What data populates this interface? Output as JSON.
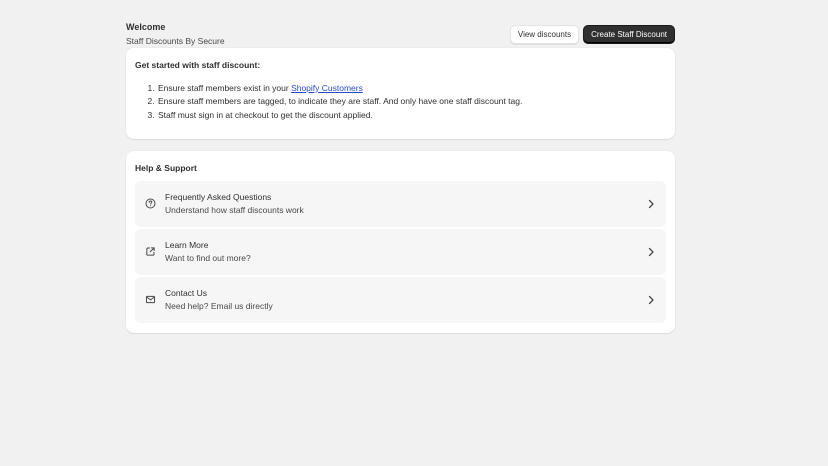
{
  "header": {
    "title": "Welcome",
    "subtitle": "Staff Discounts By Secure",
    "view_discounts_label": "View discounts",
    "create_discount_label": "Create Staff Discount"
  },
  "getting_started": {
    "heading": "Get started with staff discount:",
    "step1_prefix": "Ensure staff members exist in your ",
    "step1_link": "Shopify Customers",
    "step2": "Ensure staff members are tagged, to indicate they are staff. And only have one staff discount tag.",
    "step3": "Staff must sign in at checkout to get the discount applied."
  },
  "help": {
    "heading": "Help & Support",
    "items": [
      {
        "title": "Frequently Asked Questions",
        "description": "Understand how staff discounts work",
        "icon": "question-circle-icon"
      },
      {
        "title": "Learn More",
        "description": "Want to find out more?",
        "icon": "external-link-icon"
      },
      {
        "title": "Contact Us",
        "description": "Need help? Email us directly",
        "icon": "email-icon"
      }
    ]
  },
  "colors": {
    "background": "#f1f1f1",
    "card": "#ffffff",
    "primary_button": "#303030",
    "link": "#2b4acb"
  }
}
